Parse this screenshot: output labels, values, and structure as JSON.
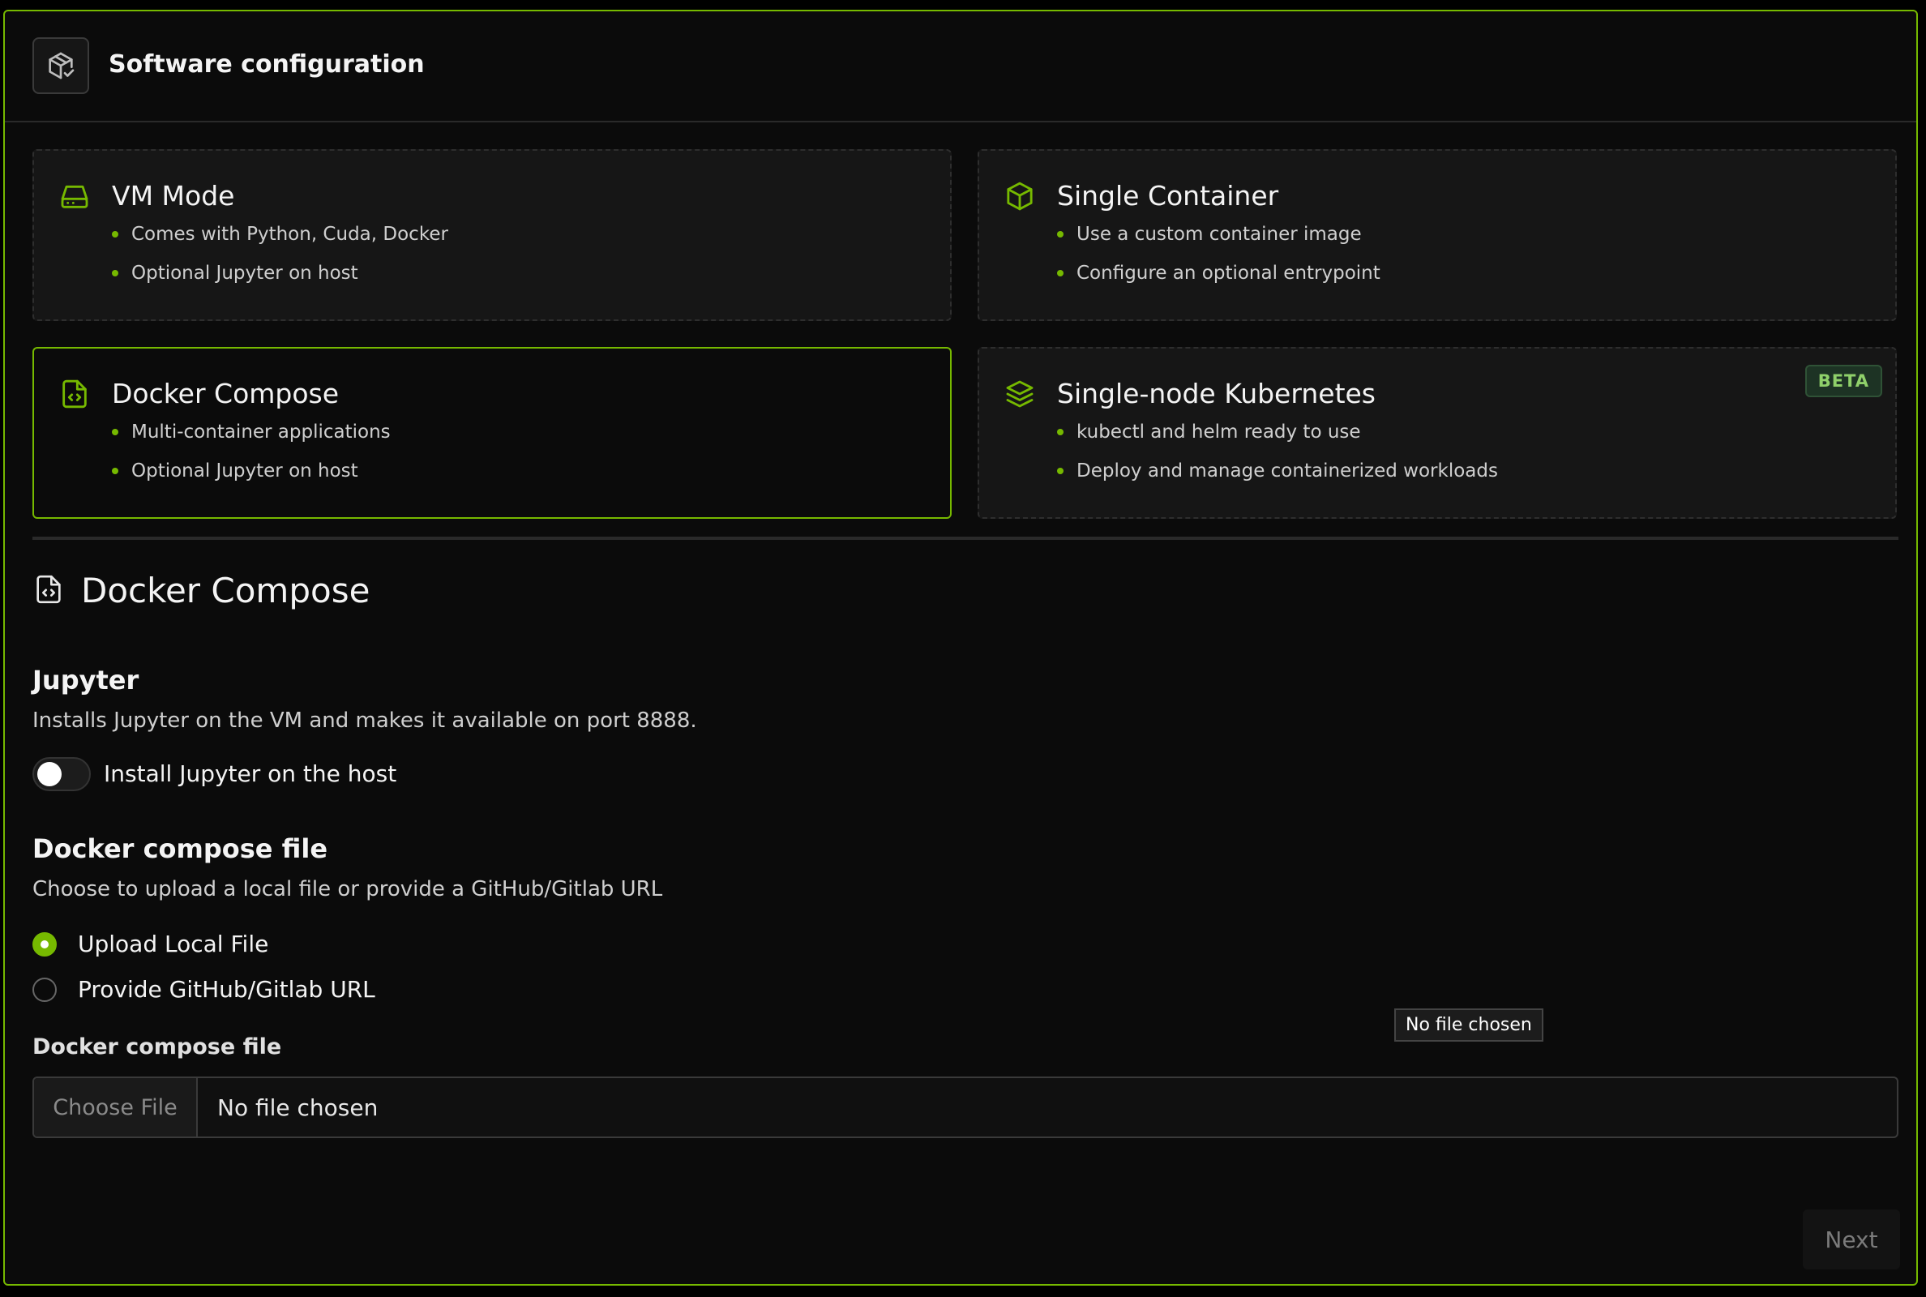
{
  "header": {
    "title": "Software configuration",
    "icon": "package-check-icon"
  },
  "modes": [
    {
      "title": "VM Mode",
      "icon": "hard-drive-icon",
      "bullets": [
        "Comes with Python, Cuda, Docker",
        "Optional Jupyter on host"
      ],
      "selected": false
    },
    {
      "title": "Single Container",
      "icon": "box-icon",
      "bullets": [
        "Use a custom container image",
        "Configure an optional entrypoint"
      ],
      "selected": false
    },
    {
      "title": "Docker Compose",
      "icon": "file-code-icon",
      "bullets": [
        "Multi-container applications",
        "Optional Jupyter on host"
      ],
      "selected": true
    },
    {
      "title": "Single-node Kubernetes",
      "icon": "layers-icon",
      "bullets": [
        "kubectl and helm ready to use",
        "Deploy and manage containerized workloads"
      ],
      "badge": "BETA",
      "selected": false
    }
  ],
  "section": {
    "title": "Docker Compose",
    "icon": "file-code-icon"
  },
  "jupyter": {
    "heading": "Jupyter",
    "description": "Installs Jupyter on the VM and makes it available on port 8888.",
    "toggle_label": "Install Jupyter on the host",
    "enabled": false
  },
  "compose": {
    "heading": "Docker compose file",
    "description": "Choose to upload a local file or provide a GitHub/Gitlab URL",
    "options": [
      {
        "label": "Upload Local File",
        "checked": true
      },
      {
        "label": "Provide GitHub/Gitlab URL",
        "checked": false
      }
    ],
    "field_label": "Docker compose file",
    "choose_button": "Choose File",
    "file_status": "No file chosen",
    "tooltip": "No file chosen"
  },
  "footer": {
    "next_label": "Next"
  },
  "colors": {
    "accent": "#76b900",
    "background": "#0b0b0b",
    "card": "#161616"
  }
}
